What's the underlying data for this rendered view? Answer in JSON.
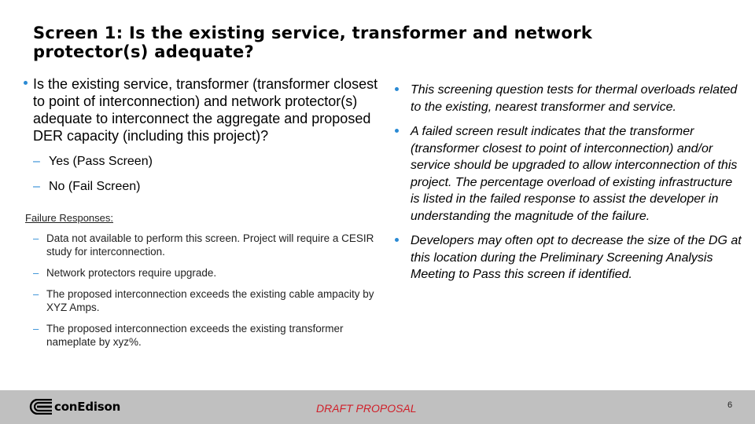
{
  "slide": {
    "title": "Screen 1: Is the existing service, transformer and network protector(s) adequate?",
    "question": "Is the existing service, transformer (transformer closest to point of interconnection) and network protector(s) adequate to interconnect the aggregate and proposed DER capacity (including this project)?",
    "options": [
      {
        "label": " Yes (Pass Screen)"
      },
      {
        "label": "No (Fail Screen)"
      }
    ],
    "failure_label": "Failure Responses:",
    "failure_responses": [
      {
        "text": "Data not available to perform this screen. Project will require a CESIR study for interconnection."
      },
      {
        "text": "Network protectors require upgrade."
      },
      {
        "text": "The proposed interconnection exceeds the existing cable ampacity by XYZ Amps."
      },
      {
        "text": "The proposed interconnection exceeds the existing transformer nameplate by xyz%."
      }
    ],
    "notes": [
      {
        "text": "This screening question tests for thermal overloads related to the existing, nearest transformer and service."
      },
      {
        "text": " A failed screen result indicates that the transformer (transformer closest to point of interconnection) and/or service should be upgraded to allow interconnection of this project.  The percentage overload of existing infrastructure is listed in the failed response to assist the developer in understanding the magnitude of the failure."
      },
      {
        "text": " Developers may often opt to decrease the size of the DG at this location during the Preliminary Screening Analysis Meeting to Pass this screen if identified."
      }
    ]
  },
  "footer": {
    "logo_text": "conEdison",
    "logo_icon": "con-edison-logo-icon",
    "draft_label": "DRAFT PROPOSAL",
    "page_number": "6"
  },
  "colors": {
    "bullet": "#2a8ad4",
    "draft": "#d0202a",
    "footer_bg": "#c0c0c0"
  }
}
